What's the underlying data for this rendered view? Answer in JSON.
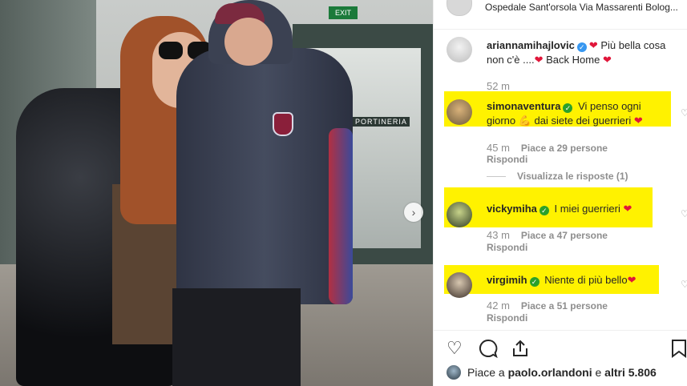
{
  "header": {
    "location": "Ospedale Sant'orsola Via Massarenti Bolog...",
    "more_icon": "more-icon"
  },
  "photo": {
    "exit_sign": "EXIT",
    "door_sign": "PORTINERIA",
    "next_icon": "chevron-right-icon"
  },
  "caption": {
    "user": "ariannamihajlovic",
    "text_1": "Più bella cosa",
    "text_2": "non c'è ....",
    "text_3": "Back Home",
    "time": "52 m"
  },
  "comments": [
    {
      "user": "simonaventura",
      "text_1": "Vi penso ogni",
      "text_2": "giorno 💪 dai siete dei guerrieri",
      "time": "45 m",
      "likes": "Piace a 29 persone",
      "reply": "Rispondi"
    },
    {
      "user": "vickymiha",
      "text_1": "I miei guerrieri",
      "time": "43 m",
      "likes": "Piace a 47 persone",
      "reply": "Rispondi"
    },
    {
      "user": "virgimih",
      "text_1": "Niente di più bello",
      "time": "42 m",
      "likes": "Piace a 51 persone",
      "reply": "Rispondi"
    }
  ],
  "view_replies": "Visualizza le risposte (1)",
  "liked_by": {
    "prefix": "Piace a",
    "user": "paolo.orlandoni",
    "middle": "e",
    "others": "altri 5.806"
  },
  "colors": {
    "highlight": "#fff200",
    "verified_blue": "#3897f0",
    "verified_green": "#2aa12a",
    "heart": "#e0163a"
  }
}
